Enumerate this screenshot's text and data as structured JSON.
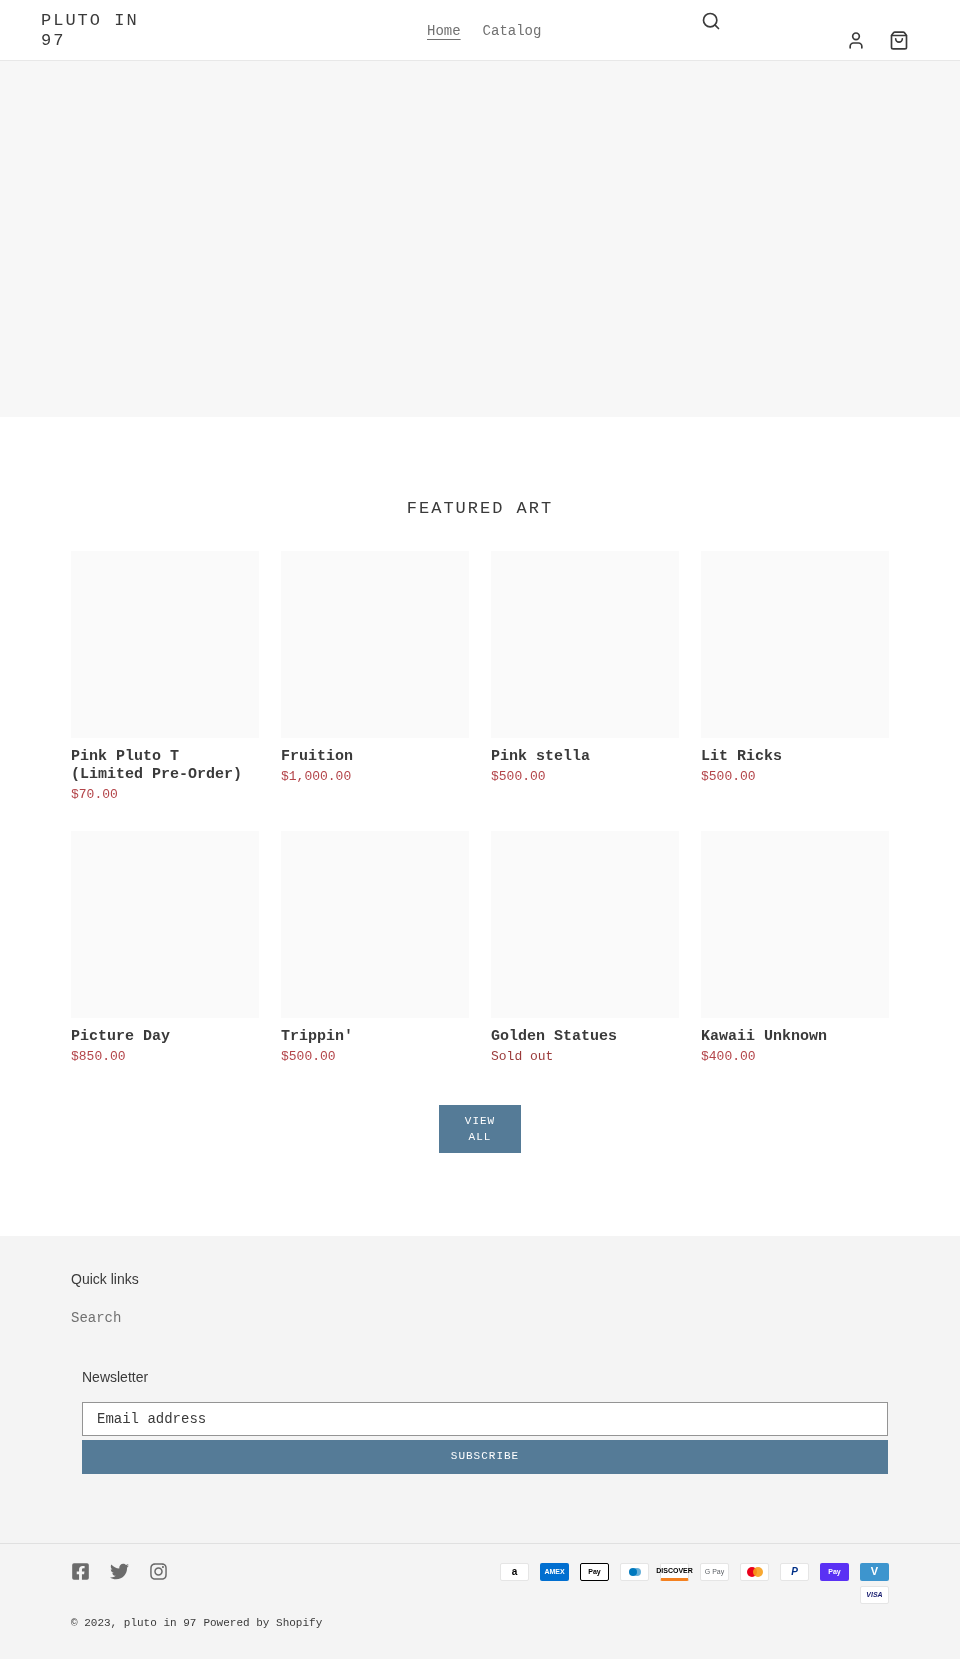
{
  "header": {
    "logo": "PLUTO IN 97",
    "nav": [
      {
        "label": "Home",
        "selected": true
      },
      {
        "label": "Catalog",
        "selected": false
      }
    ]
  },
  "featured": {
    "title": "FEATURED ART",
    "products": [
      {
        "title": "Pink Pluto T (Limited Pre-Order)",
        "price": "$70.00",
        "sold_out": false
      },
      {
        "title": "Fruition",
        "price": "$1,000.00",
        "sold_out": false
      },
      {
        "title": "Pink stella",
        "price": "$500.00",
        "sold_out": false
      },
      {
        "title": "Lit Ricks",
        "price": "$500.00",
        "sold_out": false
      },
      {
        "title": "Picture Day",
        "price": "$850.00",
        "sold_out": false
      },
      {
        "title": "Trippin'",
        "price": "$500.00",
        "sold_out": false
      },
      {
        "title": "Golden Statues",
        "price": "Sold out",
        "sold_out": true
      },
      {
        "title": "Kawaii Unknown",
        "price": "$400.00",
        "sold_out": false
      }
    ],
    "view_all": "VIEW ALL"
  },
  "footer": {
    "quick_links": {
      "title": "Quick links",
      "links": [
        "Search"
      ]
    },
    "newsletter": {
      "title": "Newsletter",
      "placeholder": "Email address",
      "button": "SUBSCRIBE"
    },
    "payment_methods": [
      {
        "kind": "amazon",
        "label": "a"
      },
      {
        "kind": "amex",
        "label": "AMEX"
      },
      {
        "kind": "apple",
        "label": "Pay"
      },
      {
        "kind": "diners"
      },
      {
        "kind": "discover",
        "label": "DISCOVER"
      },
      {
        "kind": "google",
        "label": "G Pay"
      },
      {
        "kind": "mastercard"
      },
      {
        "kind": "paypal",
        "label": "P"
      },
      {
        "kind": "shop",
        "label": "Pay"
      },
      {
        "kind": "venmo",
        "label": "V"
      },
      {
        "kind": "visa",
        "label": "VISA"
      }
    ],
    "copyright": "© 2023, pluto in 97",
    "powered": "Powered by Shopify"
  }
}
